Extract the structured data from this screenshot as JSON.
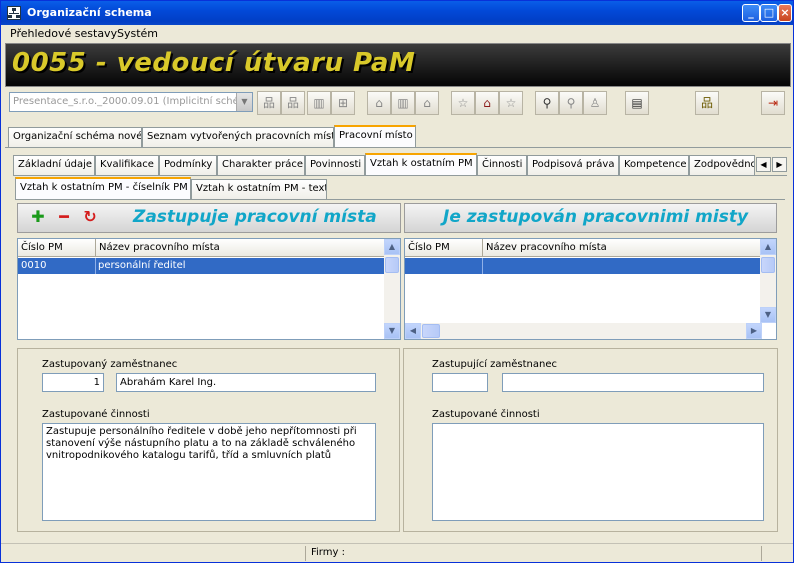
{
  "window": {
    "title": "Organizační schema"
  },
  "menu": {
    "items": [
      "Přehledové sestavy",
      "Systém"
    ]
  },
  "banner": {
    "title": "0055 - vedoucí útvaru PaM"
  },
  "toolbar": {
    "combo_value": "Presentace_s.r.o._2000.09.01   (Implicitní sché",
    "icons": [
      "org-chart-icon",
      "org-chart-down-icon",
      "building-icon",
      "tree-icon",
      "hierarchy-icon",
      "house-icon",
      "house-up-icon",
      "house-alt-icon",
      "star-icon",
      "home-icon",
      "people-icon",
      "search-icon",
      "zoom-icon",
      "refresh-person-icon",
      "print-icon",
      "network-icon",
      "exit-door-icon"
    ]
  },
  "main_tabs": [
    "Organizační schéma nové",
    "Seznam vytvořených pracovních míst",
    "Pracovní místo"
  ],
  "sub_tabs": [
    "Základní údaje",
    "Kvalifikace",
    "Podmínky",
    "Charakter práce",
    "Povinnosti",
    "Vztah k ostatním PM",
    "Činnosti",
    "Podpisová práva",
    "Kompetence",
    "Zodpovědno"
  ],
  "inner_tabs": [
    "Vztah k ostatním PM - číselník PM",
    "Vztah k ostatním PM - text"
  ],
  "left_panel": {
    "title": "Zastupuje pracovní místa",
    "col1": "Číslo PM",
    "col2": "Název pracovního místa",
    "rows": [
      {
        "cislo": "0010",
        "nazev": "personální ředitel"
      }
    ]
  },
  "right_panel": {
    "title": "Je zastupován pracovnimi misty",
    "col1": "Číslo PM",
    "col2": "Název pracovního místa"
  },
  "left_detail": {
    "employee_label": "Zastupovaný zaměstnanec",
    "employee_no": "1",
    "employee_name": "Abrahám  Karel  Ing.",
    "activities_label": "Zastupované činnosti",
    "activities_text": "Zastupuje personálního ředitele v době jeho nepřítomnosti při stanovení výše nástupního platu a to na základě schváleného vnitropodnikového katalogu tarifů, tříd a smluvních platů"
  },
  "right_detail": {
    "employee_label": "Zastupující zaměstnanec",
    "activities_label": "Zastupované činnosti"
  },
  "status": {
    "firmy_label": "Firmy :"
  }
}
